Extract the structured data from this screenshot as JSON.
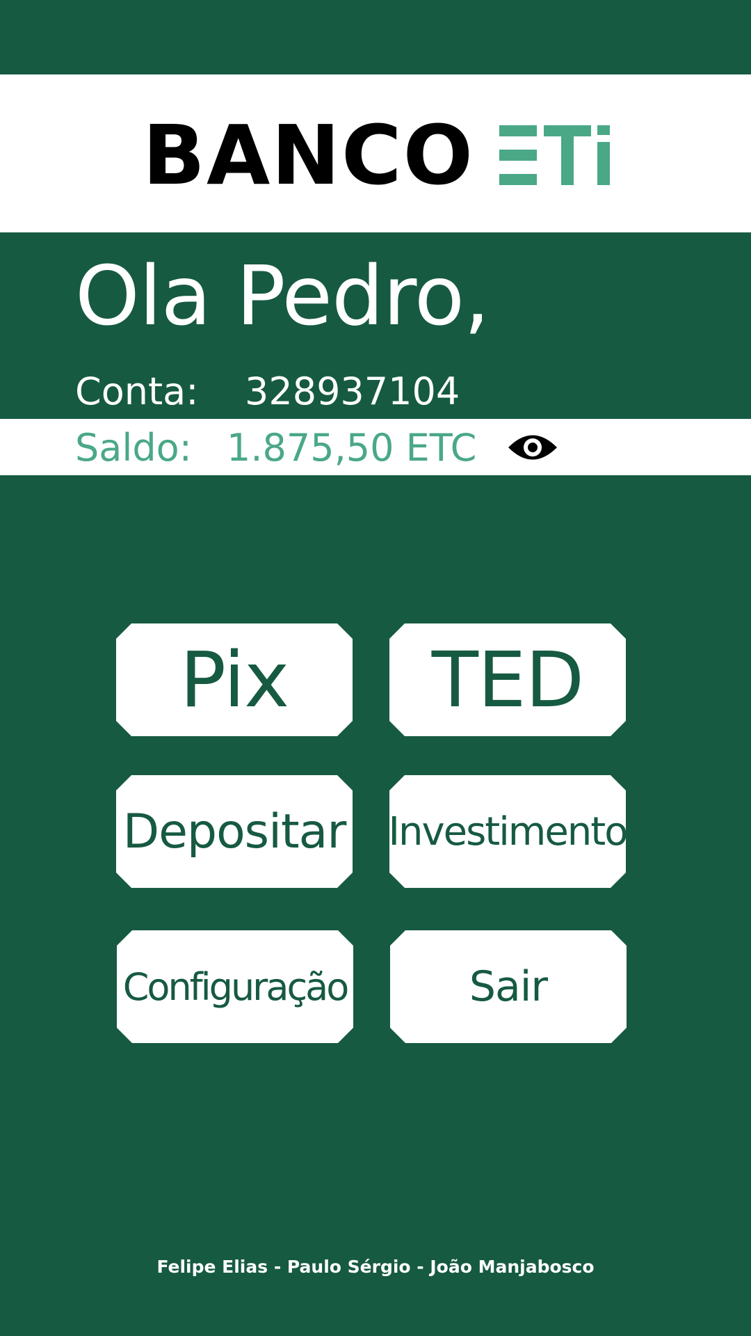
{
  "brand": {
    "name_bold": "BANCO",
    "name_accent": "ETi",
    "accent_color": "#4aa886",
    "background_color": "#165a41"
  },
  "greeting": "Ola Pedro,",
  "account": {
    "label": "Conta:",
    "number": "328937104"
  },
  "balance": {
    "label": "Saldo:",
    "value": "1.875,50 ETC",
    "toggle_icon": "eye-icon"
  },
  "actions": {
    "pix": "Pix",
    "ted": "TED",
    "depositar": "Depositar",
    "investimento": "Investimento",
    "configuracao": "Configuração",
    "sair": "Sair"
  },
  "footer": {
    "credits": "Felipe Elias - Paulo Sérgio - João Manjabosco"
  }
}
